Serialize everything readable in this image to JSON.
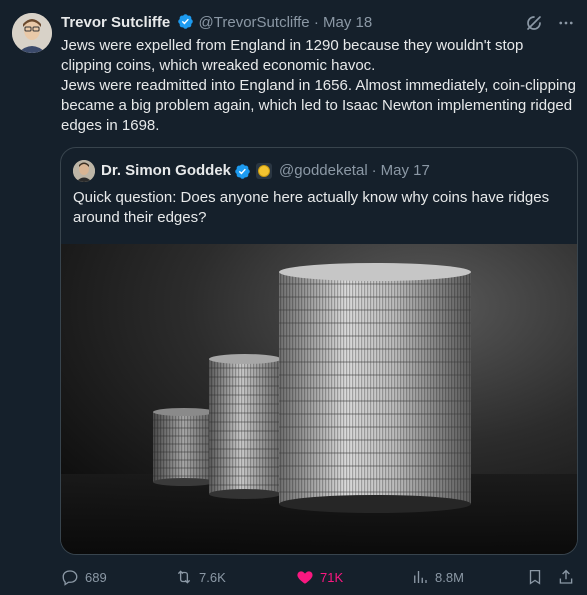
{
  "tweet": {
    "author_name": "Trevor Sutcliffe",
    "handle": "@TrevorSutcliffe",
    "separator": "·",
    "date": "May 18",
    "text": "Jews were expelled from England in 1290 because they wouldn't stop clipping coins, which wreaked economic havoc.\nJews were readmitted into England in 1656. Almost immediately, coin-clipping became a big problem again, which led to Isaac Newton implementing ridged edges in 1698."
  },
  "quote": {
    "author_name": "Dr. Simon Goddek",
    "handle": "@goddeketal",
    "separator": "·",
    "date": "May 17",
    "text": "Quick question: Does anyone here actually know why coins have ridges around their edges?"
  },
  "actions": {
    "replies": "689",
    "reposts": "7.6K",
    "likes": "71K",
    "views": "8.8M"
  },
  "colors": {
    "background": "#15202b",
    "verified": "#1d9bf0",
    "like": "#f91880",
    "muted": "#8b98a5"
  },
  "icons": [
    "verified-badge-icon",
    "grok-icon",
    "more-icon",
    "gold-badge-icon",
    "reply-icon",
    "repost-icon",
    "like-icon",
    "views-icon",
    "bookmark-icon",
    "share-icon"
  ]
}
